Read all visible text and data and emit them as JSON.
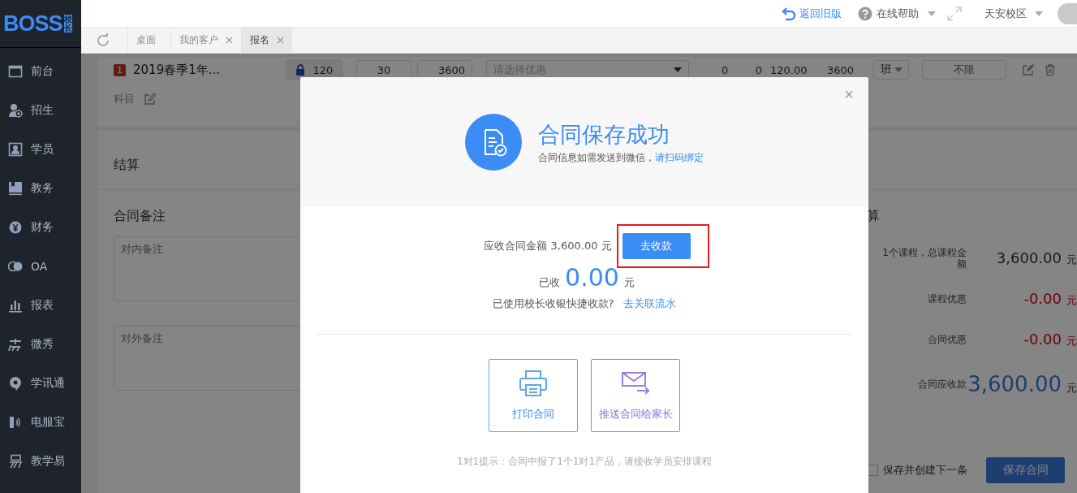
{
  "logo": {
    "text": "BOSS",
    "tag": "校长"
  },
  "sidebar": {
    "items": [
      {
        "label": "前台"
      },
      {
        "label": "招生"
      },
      {
        "label": "学员"
      },
      {
        "label": "教务"
      },
      {
        "label": "财务"
      },
      {
        "label": "OA"
      },
      {
        "label": "报表"
      },
      {
        "label": "微秀"
      },
      {
        "label": "学讯通"
      },
      {
        "label": "电服宝"
      },
      {
        "label": "教学易"
      }
    ]
  },
  "header": {
    "back_link": "返回旧版",
    "help": "在线帮助",
    "campus": "天安校区"
  },
  "tabs": [
    {
      "label": "桌面",
      "closable": false,
      "selected": false
    },
    {
      "label": "我的客户",
      "closable": true,
      "selected": false
    },
    {
      "label": "报名",
      "closable": true,
      "selected": true
    }
  ],
  "course_row": {
    "index": "1",
    "title": "2019春季1年...",
    "subject_label": "科目",
    "price": "120",
    "price_locked": true,
    "count": "30",
    "amount": "3600",
    "discount_placeholder": "请选择优惠",
    "column_1": "0",
    "column_2": "0",
    "column_3": "120.00",
    "column_4": "3600",
    "unit": "班",
    "limit": "不限"
  },
  "settlement": {
    "title": "结算",
    "notes_title": "合同备注",
    "internal_placeholder": "对内备注",
    "external_placeholder": "对外备注",
    "summary_title": "算",
    "summary": [
      {
        "label": "1个课程，总课程金额",
        "value": "3,600.00",
        "unit": "元",
        "kind": "normal"
      },
      {
        "label": "课程优惠",
        "value": "-0.00",
        "unit": "元",
        "kind": "discount"
      },
      {
        "label": "合同优惠",
        "value": "-0.00",
        "unit": "元",
        "kind": "discount"
      },
      {
        "label": "合同应收款",
        "value": "3,600.00",
        "unit": "元",
        "kind": "total"
      }
    ],
    "save_next": {
      "label": "保存并创建下一条",
      "checked": false
    },
    "save_button": "保存合同"
  },
  "dialog": {
    "title": "合同保存成功",
    "subtitle": "合同信息如需发送到微信，",
    "bind_link": "请扫码绑定",
    "close": "×",
    "receivable_label": "应收合同金额 3,600.00 元",
    "collect_button": "去收款",
    "collect_highlighted": true,
    "received_label": "已收",
    "received_value": "0.00",
    "received_unit": "元",
    "quick_question": "已使用校长收银快捷收款?",
    "quick_link": "去关联流水",
    "actions": [
      {
        "label": "打印合同",
        "kind": "print"
      },
      {
        "label": "推送合同给家长",
        "kind": "mail"
      }
    ],
    "hint": "1对1提示：合同中报了1个1对1产品，请接收学员安排课程"
  }
}
